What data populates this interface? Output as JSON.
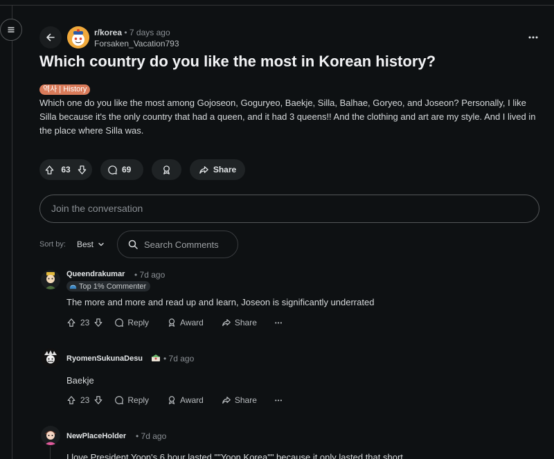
{
  "post": {
    "subreddit": "r/korea",
    "time": "7 days ago",
    "author": "Forsaken_Vacation793",
    "title": "Which country do you like the most in Korean history?",
    "flair": "역사 | History",
    "body": "Which one do you like the most among Gojoseon, Goguryeo, Baekje, Silla, Balhae, Goryeo, and Joseon? Personally, I like Silla because it's the only country that had a queen, and it had 3 queens!! And the clothing and art are my style. And I lived in the place where Silla was.",
    "votes": "63",
    "comments": "69",
    "share_label": "Share"
  },
  "join_placeholder": "Join the conversation",
  "sort": {
    "label": "Sort by:",
    "value": "Best"
  },
  "search_placeholder": "Search Comments",
  "comments": [
    {
      "user": "Queendrakumar",
      "time": "7d ago",
      "badge": "Top 1% Commenter",
      "text": "The more and more and read up and learn, Joseon is significantly underrated",
      "votes": "23",
      "reply": "Reply",
      "award": "Award",
      "share": "Share",
      "more": "•••"
    },
    {
      "user": "RyomenSukunaDesu",
      "time": "7d ago",
      "text": "Baekje",
      "votes": "23",
      "reply": "Reply",
      "award": "Award",
      "share": "Share",
      "more": "•••"
    },
    {
      "user": "NewPlaceHolder",
      "time": "7d ago",
      "text": "I love President Yoon's 6 hour lasted \"\"Yoon Korea\"\" because it only lasted that short"
    }
  ],
  "separator": "•",
  "icons": [
    "menu-icon",
    "back-arrow-icon",
    "more-icon",
    "upvote-icon",
    "downvote-icon",
    "comment-icon",
    "award-icon",
    "share-icon",
    "search-icon",
    "chevron-down-icon"
  ],
  "colors": {
    "background": "#0e1113",
    "flair": "#d97b5a",
    "pill": "#1f2325",
    "subreddit_avatar": "#f0a93b"
  }
}
